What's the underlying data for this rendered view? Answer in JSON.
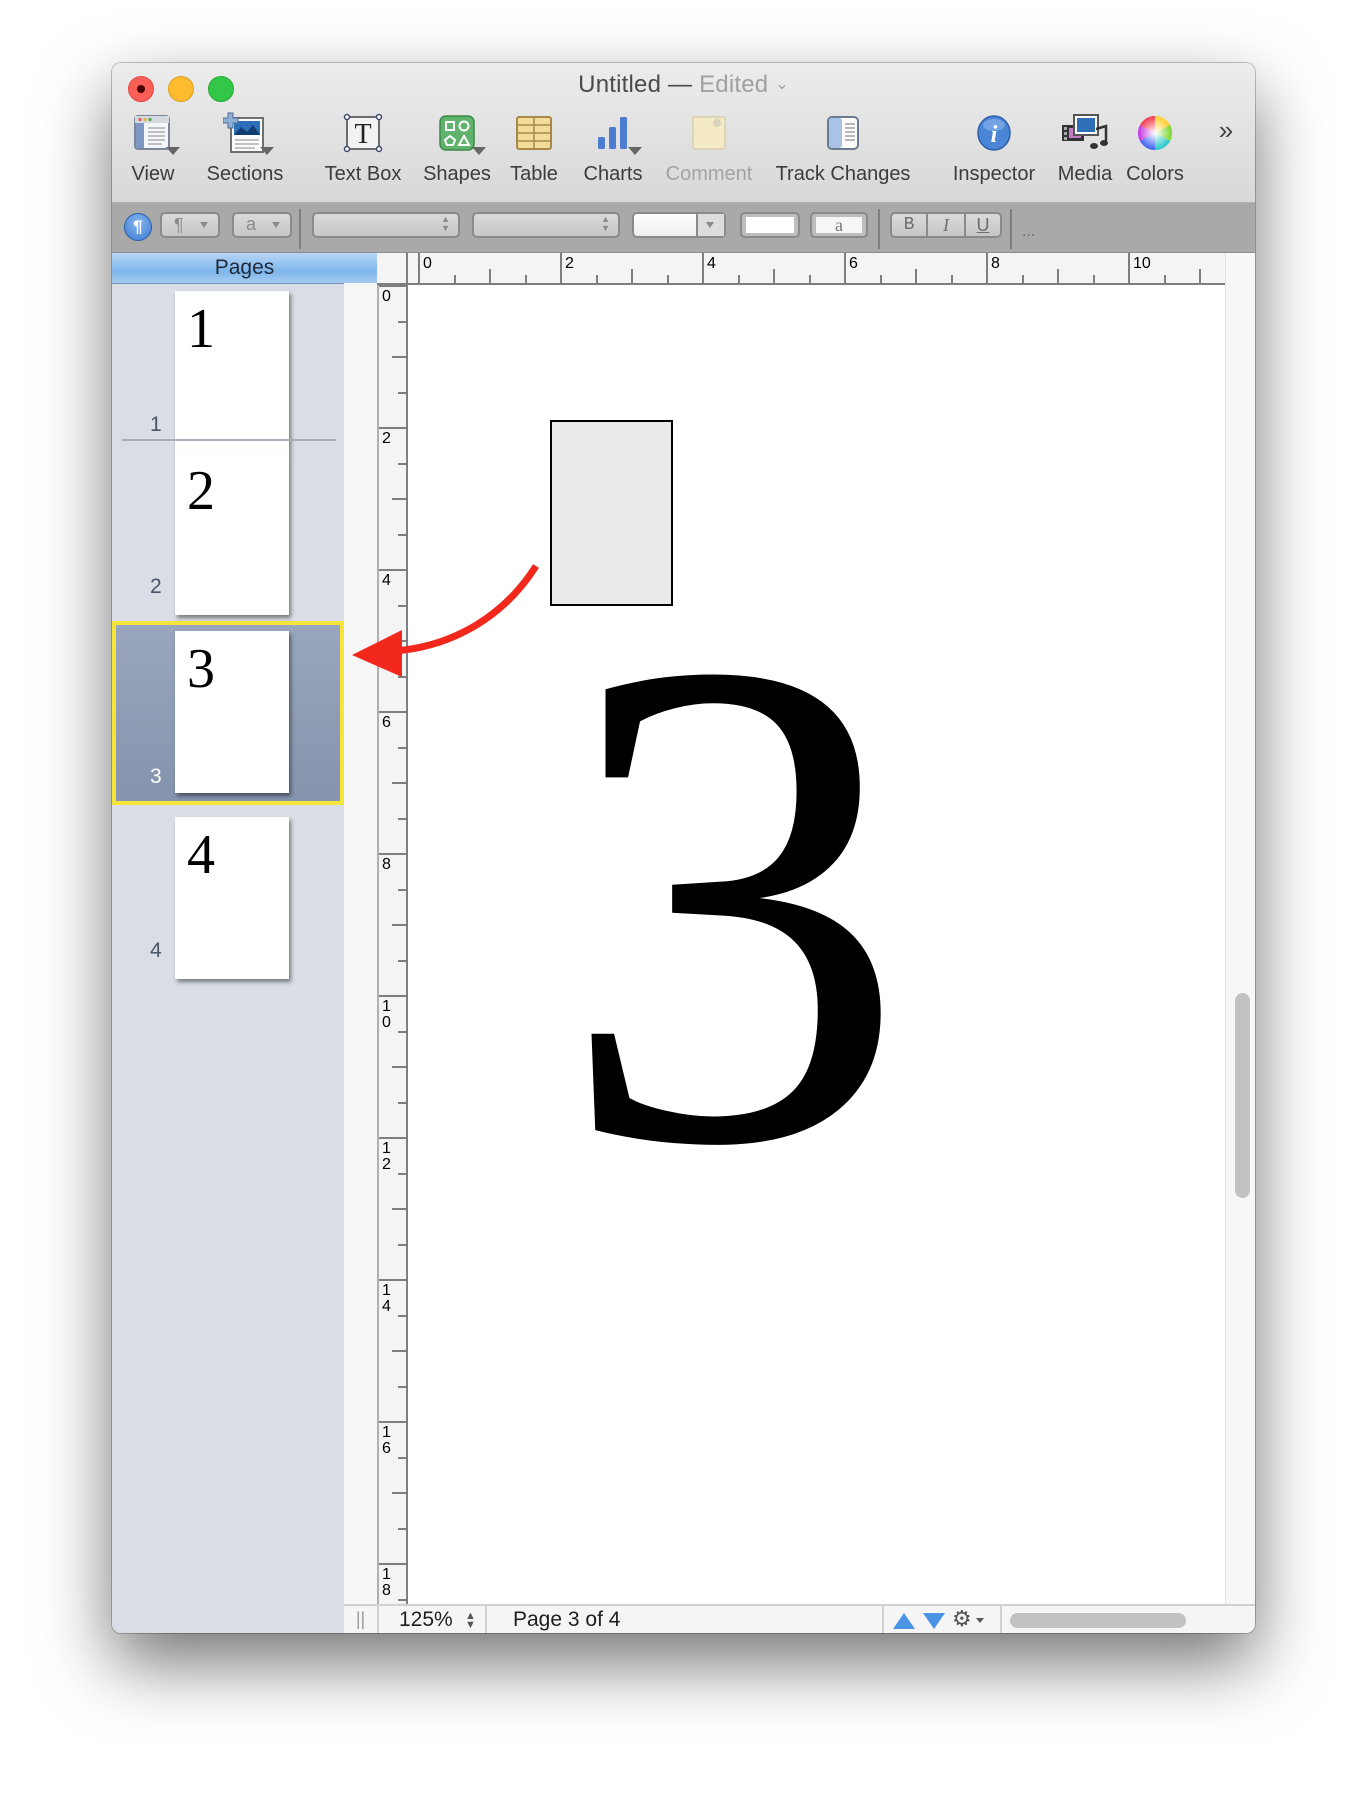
{
  "window": {
    "title": "Untitled",
    "title_separator": " — ",
    "status": "Edited",
    "status_chevron": "⌄"
  },
  "toolbar": {
    "items": [
      {
        "id": "view",
        "label": "View",
        "icon": "view-icon",
        "has_dropdown": true,
        "enabled": true
      },
      {
        "id": "sections",
        "label": "Sections",
        "icon": "sections-icon",
        "has_dropdown": true,
        "enabled": true
      },
      {
        "id": "text-box",
        "label": "Text Box",
        "icon": "text-box-icon",
        "has_dropdown": false,
        "enabled": true
      },
      {
        "id": "shapes",
        "label": "Shapes",
        "icon": "shapes-icon",
        "has_dropdown": true,
        "enabled": true
      },
      {
        "id": "table",
        "label": "Table",
        "icon": "table-icon",
        "has_dropdown": false,
        "enabled": true
      },
      {
        "id": "charts",
        "label": "Charts",
        "icon": "charts-icon",
        "has_dropdown": true,
        "enabled": true
      },
      {
        "id": "comment",
        "label": "Comment",
        "icon": "comment-icon",
        "has_dropdown": false,
        "enabled": false
      },
      {
        "id": "track-changes",
        "label": "Track Changes",
        "icon": "track-changes-icon",
        "has_dropdown": false,
        "enabled": true
      },
      {
        "id": "inspector",
        "label": "Inspector",
        "icon": "info-icon",
        "has_dropdown": false,
        "enabled": true
      },
      {
        "id": "media",
        "label": "Media",
        "icon": "media-icon",
        "has_dropdown": false,
        "enabled": true
      },
      {
        "id": "colors",
        "label": "Colors",
        "icon": "color-wheel-icon",
        "has_dropdown": false,
        "enabled": true
      }
    ],
    "overflow_label": "»",
    "text_box_glyph": "T",
    "inspector_glyph": "i"
  },
  "format_bar": {
    "paragraph_glyph": "¶",
    "char_style_glyph": "a",
    "text_color_glyph": "a",
    "bold": "B",
    "italic": "I",
    "underline": "U",
    "more": "..."
  },
  "sidebar": {
    "header": "Pages",
    "pages": [
      {
        "number": "1",
        "thumb_text": "1",
        "selected": false
      },
      {
        "number": "2",
        "thumb_text": "2",
        "selected": false
      },
      {
        "number": "3",
        "thumb_text": "3",
        "selected": true
      },
      {
        "number": "4",
        "thumb_text": "4",
        "selected": false
      }
    ]
  },
  "rulers": {
    "horizontal_labels": [
      "0",
      "2",
      "4",
      "6",
      "8",
      "10"
    ],
    "vertical_labels": [
      "0",
      "2",
      "4",
      "6",
      "8",
      "10",
      "12",
      "14",
      "16",
      "18"
    ]
  },
  "document": {
    "content_text": "3"
  },
  "annotation": {
    "arrow_color": "#f2281c",
    "highlight_color": "#f5e53a"
  },
  "status_bar": {
    "grip": "||",
    "zoom": "125%",
    "page_label": "Page 3 of 4",
    "gear_glyph": "⚙"
  }
}
